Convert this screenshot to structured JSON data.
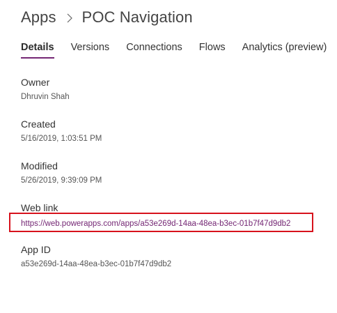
{
  "breadcrumb": {
    "root": "Apps",
    "current": "POC Navigation",
    "separator_icon": "chevron-right-icon"
  },
  "tabs": [
    {
      "label": "Details",
      "active": true
    },
    {
      "label": "Versions",
      "active": false
    },
    {
      "label": "Connections",
      "active": false
    },
    {
      "label": "Flows",
      "active": false
    },
    {
      "label": "Analytics (preview)",
      "active": false
    }
  ],
  "details": {
    "owner": {
      "label": "Owner",
      "value": "Dhruvin Shah"
    },
    "created": {
      "label": "Created",
      "value": "5/16/2019, 1:03:51 PM"
    },
    "modified": {
      "label": "Modified",
      "value": "5/26/2019, 9:39:09 PM"
    },
    "web_link": {
      "label": "Web link",
      "value": "https://web.powerapps.com/apps/a53e269d-14aa-48ea-b3ec-01b7f47d9db2"
    },
    "app_id": {
      "label": "App ID",
      "value": "a53e269d-14aa-48ea-b3ec-01b7f47d9db2"
    }
  },
  "colors": {
    "accent": "#742774",
    "highlight_box": "#d7121c"
  }
}
